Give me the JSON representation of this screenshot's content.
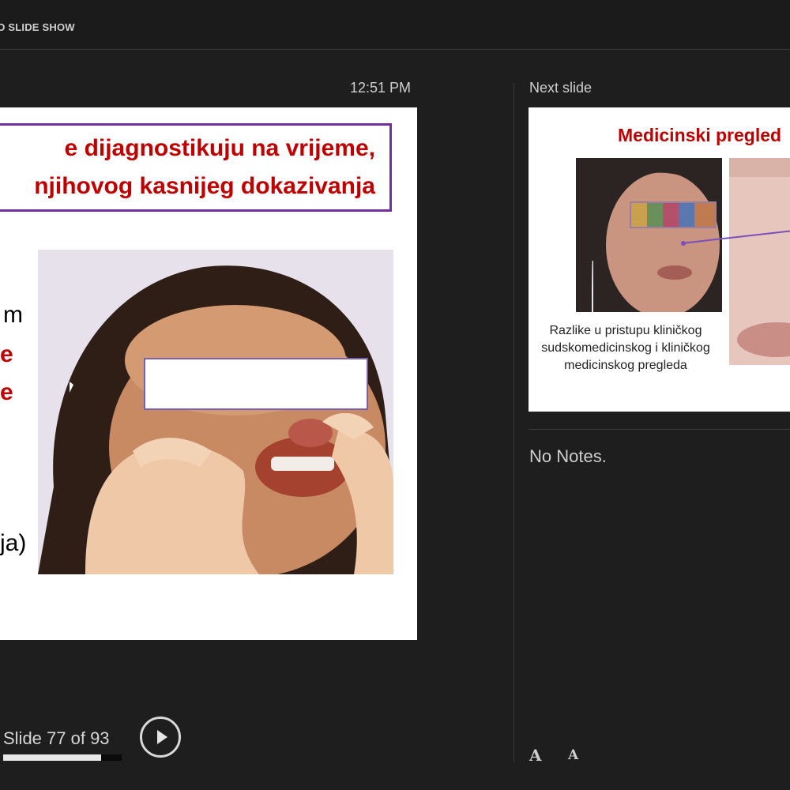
{
  "topbar": {
    "label": "D SLIDE SHOW"
  },
  "clock": "12:51 PM",
  "next_slide_label": "Next slide",
  "current_slide": {
    "title_line1": "e dijagnostikuju na vrijeme,",
    "title_line2": "njihovog kasnijeg dokazivanja",
    "body": [
      {
        "text": "m",
        "style": "black"
      },
      {
        "text": "e",
        "style": "red"
      },
      {
        "text": "e",
        "style": "red"
      },
      {
        "text": "ja)",
        "style": "black"
      }
    ]
  },
  "next_slide": {
    "title": "Medicinski pregled",
    "caption": "Razlike u pristupu kliničkog sudskomedicinskog i kliničkog medicinskog pregleda"
  },
  "notes": "No Notes.",
  "navigation": {
    "slide_counter": "Slide 77 of 93",
    "progress_fraction": 0.828
  },
  "font_controls": {
    "increase": "A",
    "decrease": "A"
  },
  "colors": {
    "accent_red": "#c00000",
    "box_purple": "#7030a0",
    "background": "#1e1e1e"
  }
}
